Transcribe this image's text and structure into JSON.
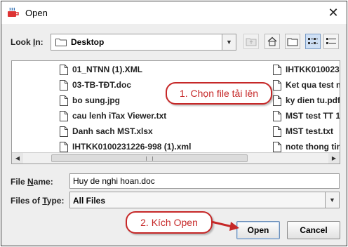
{
  "window": {
    "title": "Open",
    "close_label": "✕"
  },
  "look_in": {
    "label_pre": "Look ",
    "label_u": "I",
    "label_post": "n:",
    "value": "Desktop"
  },
  "toolbar": {
    "buttons": [
      {
        "name": "up-folder-button",
        "icon": "up-folder-icon",
        "state": "disabled"
      },
      {
        "name": "home-button",
        "icon": "home-icon",
        "state": "normal"
      },
      {
        "name": "new-folder-button",
        "icon": "new-folder-icon",
        "state": "normal"
      },
      {
        "name": "list-view-button",
        "icon": "list-view-icon",
        "state": "active"
      },
      {
        "name": "details-view-button",
        "icon": "details-view-icon",
        "state": "normal"
      }
    ]
  },
  "files": {
    "left": [
      "01_NTNN (1).XML",
      "03-TB-TĐT.doc",
      "bo sung.jpg",
      "cau lenh iTax Viewer.txt",
      "Danh sach MST.xlsx",
      "IHTKK0100231226-998 (1).xml"
    ],
    "right": [
      "IHTKK010023",
      "Ket qua test m",
      "ky dien tu.pdf",
      "MST test TT 1",
      "MST test.txt",
      "note thong tin"
    ]
  },
  "file_name": {
    "label_pre": "File ",
    "label_u": "N",
    "label_post": "ame:",
    "value": "Huy de nghi hoan.doc"
  },
  "files_of_type": {
    "label_pre": "Files of ",
    "label_u": "T",
    "label_post": "ype:",
    "value": "All Files"
  },
  "buttons": {
    "open": "Open",
    "cancel": "Cancel"
  },
  "callouts": {
    "choose_file": "1. Chọn file  tải lên",
    "click_open": "2. Kích Open"
  },
  "colors": {
    "callout": "#c62828",
    "folder": "#e0b64a",
    "active_view": "#cfe0f5"
  }
}
